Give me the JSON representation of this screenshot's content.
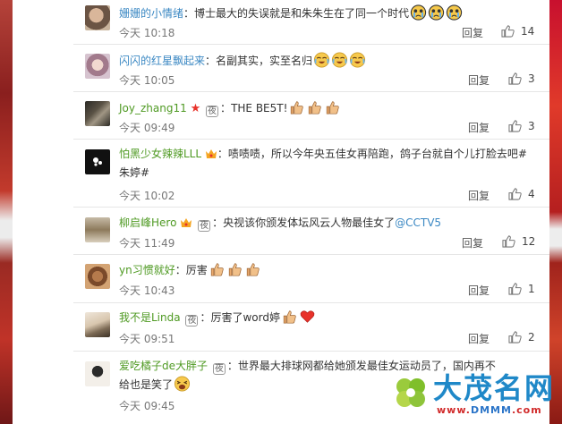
{
  "comments": [
    {
      "user": "姗姗的小情绪",
      "vip": false,
      "badge": "",
      "text": "博士最大的失误就是和朱朱生在了同一个时代",
      "emoji": "weeping",
      "emoji_count": 3,
      "time": "今天 10:18",
      "reply": "回复",
      "likes": "14"
    },
    {
      "user": "闪闪的红星飘起来",
      "vip": false,
      "badge": "",
      "text": "名副其实，实至名归",
      "emoji": "tears-of-joy",
      "emoji_count": 3,
      "time": "今天 10:05",
      "reply": "回复",
      "likes": "3"
    },
    {
      "user": "Joy_zhang11",
      "vip": false,
      "star": "★",
      "badge": "夜",
      "text": "THE BE5T!",
      "emoji": "thumbs-up",
      "emoji_count": 3,
      "time": "今天 09:49",
      "reply": "回复",
      "likes": "3"
    },
    {
      "user": "怕黑少女辣辣LLL",
      "vip": true,
      "badge": "",
      "text": "啧啧啧，所以今年央五佳女再陪跑，鸽子台就自个儿打脸去吧#朱婷#",
      "emoji": "",
      "emoji_count": 0,
      "time": "今天 10:02",
      "reply": "回复",
      "likes": "4"
    },
    {
      "user": "柳启峰Hero",
      "vip": true,
      "badge": "夜",
      "text": "央视该你颁发体坛风云人物最佳女了",
      "mention": "@CCTV5",
      "emoji": "",
      "emoji_count": 0,
      "time": "今天 11:49",
      "reply": "回复",
      "likes": "12"
    },
    {
      "user": "yn习惯就好",
      "vip": false,
      "badge": "",
      "text": "厉害",
      "emoji": "thumbs-up",
      "emoji_count": 3,
      "time": "今天 10:43",
      "reply": "回复",
      "likes": "1"
    },
    {
      "user": "我不是Linda",
      "vip": false,
      "badge": "夜",
      "text": "厉害了word婷",
      "emoji": "thumb-heart",
      "emoji_count": 2,
      "time": "今天 09:51",
      "reply": "回复",
      "likes": "2"
    },
    {
      "user": "爱吃橘子de大胖子",
      "vip": false,
      "badge": "夜",
      "text": "世界最大排球网都给她颁发最佳女运动员了，国内再不给也是笑了",
      "emoji": "laughing",
      "emoji_count": 1,
      "time": "今天 09:45",
      "reply": "",
      "likes": ""
    }
  ],
  "watermark": {
    "name": "大茂名网",
    "url_a": "www.",
    "url_b": "DMMM",
    "url_c": ".com"
  },
  "colors": {
    "username": "#3b88c3",
    "username_alt": "#4f9a23",
    "accent_red": "#e8322a"
  }
}
